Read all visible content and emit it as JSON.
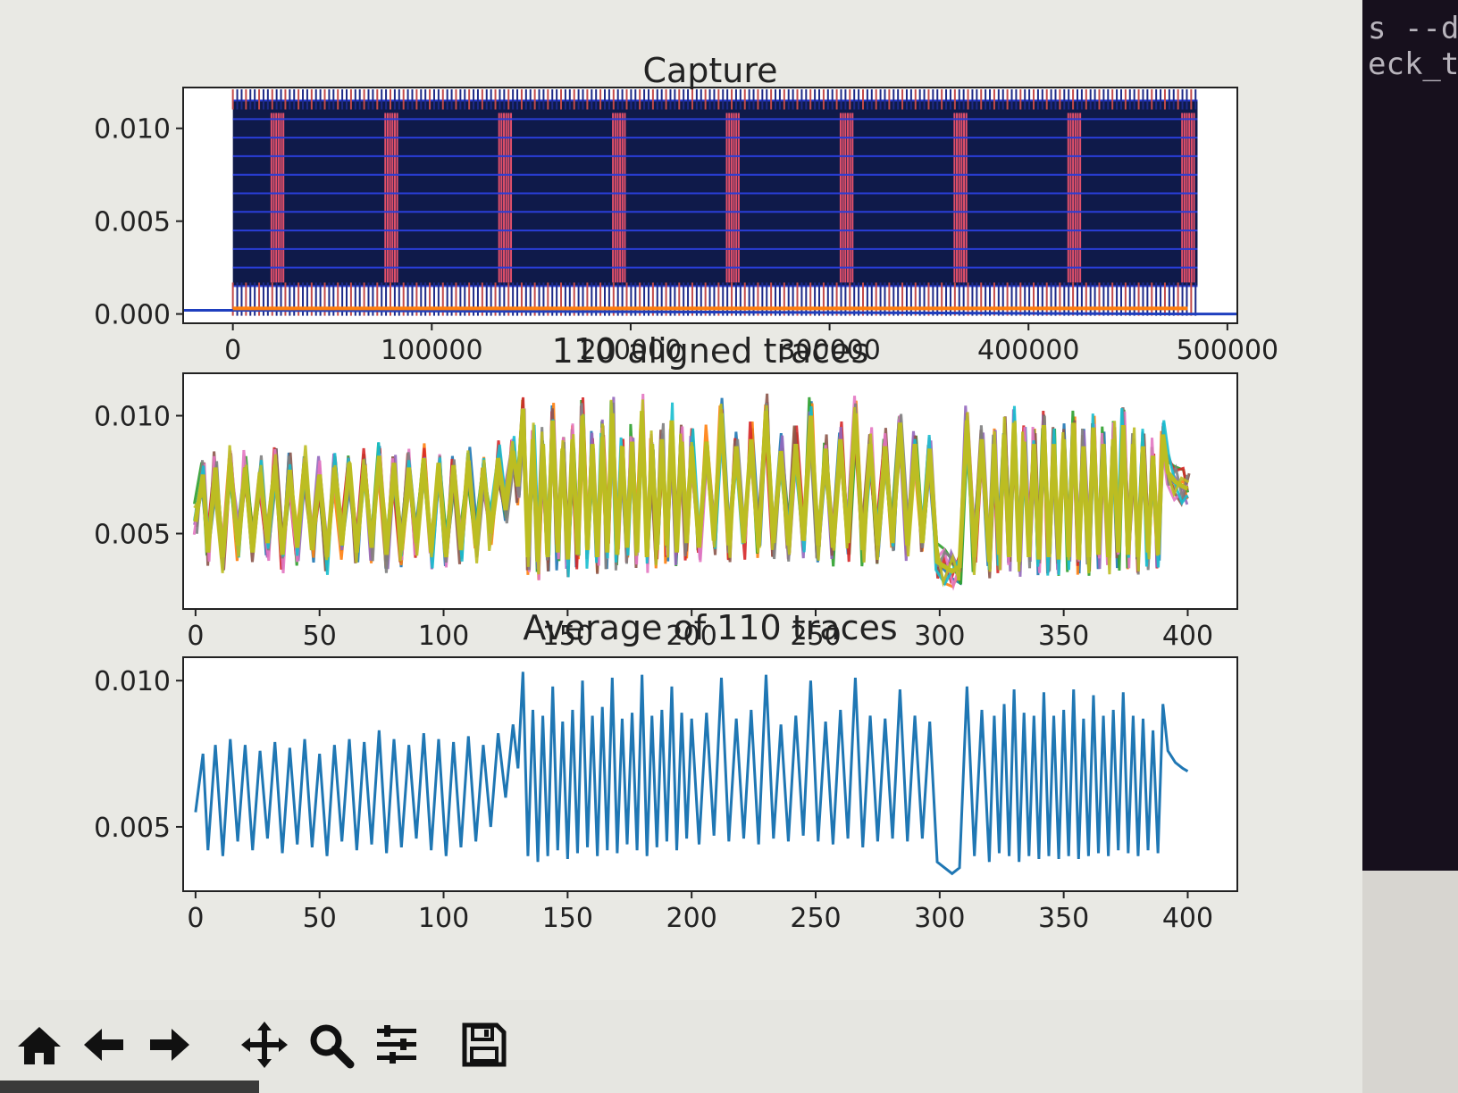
{
  "terminal": {
    "lines": [
      "s --d",
      "eck_t"
    ]
  },
  "toolbar": {
    "buttons": [
      {
        "name": "home-icon",
        "label": "Home"
      },
      {
        "name": "back-icon",
        "label": "Back"
      },
      {
        "name": "forward-icon",
        "label": "Forward"
      },
      {
        "name": "pan-icon",
        "label": "Pan"
      },
      {
        "name": "zoom-icon",
        "label": "Zoom"
      },
      {
        "name": "configure-subplots-icon",
        "label": "Configure subplots"
      },
      {
        "name": "save-icon",
        "label": "Save"
      }
    ]
  },
  "chart_data": [
    {
      "type": "line",
      "title": "Capture",
      "xlabel": "",
      "ylabel": "",
      "xlim": [
        -25000,
        505000
      ],
      "ylim": [
        -0.0005,
        0.0122
      ],
      "xticks": [
        0,
        100000,
        200000,
        300000,
        400000,
        500000
      ],
      "xtick_labels": [
        "0",
        "100000",
        "200000",
        "300000",
        "400000",
        "500000"
      ],
      "yticks": [
        0.0,
        0.005,
        0.01
      ],
      "ytick_labels": [
        "0.000",
        "0.005",
        "0.010"
      ],
      "series": [
        {
          "color": "#1f3fbf",
          "x": [
            -25000,
            0,
            480000,
            505000
          ],
          "y": [
            0.0002,
            0.0002,
            0.0,
            0.0
          ],
          "band": {
            "x0": 0,
            "x1": 485000,
            "y0": 0.0015,
            "y1": 0.0115
          }
        },
        {
          "color": "#ff7f0e",
          "x": [
            0,
            480000
          ],
          "y": [
            0.0003,
            0.0003
          ]
        }
      ],
      "grid": false
    },
    {
      "type": "line",
      "title": "110 aligned traces",
      "xlabel": "",
      "ylabel": "",
      "xlim": [
        -5,
        420
      ],
      "ylim": [
        0.0018,
        0.0118
      ],
      "xticks": [
        0,
        50,
        100,
        150,
        200,
        250,
        300,
        350,
        400
      ],
      "xtick_labels": [
        "0",
        "50",
        "100",
        "150",
        "200",
        "250",
        "300",
        "350",
        "400"
      ],
      "yticks": [
        0.005,
        0.01
      ],
      "ytick_labels": [
        "0.005",
        "0.010"
      ],
      "n_traces": 110,
      "trace_colors": [
        "#1f77b4",
        "#ff7f0e",
        "#2ca02c",
        "#d62728",
        "#9467bd",
        "#8c564b",
        "#e377c2",
        "#7f7f7f",
        "#17becf",
        "#bcbd22"
      ],
      "grid": false
    },
    {
      "type": "line",
      "title": "Average of 110 traces",
      "xlabel": "",
      "ylabel": "",
      "xlim": [
        -5,
        420
      ],
      "ylim": [
        0.0028,
        0.0108
      ],
      "xticks": [
        0,
        50,
        100,
        150,
        200,
        250,
        300,
        350,
        400
      ],
      "xtick_labels": [
        "0",
        "50",
        "100",
        "150",
        "200",
        "250",
        "300",
        "350",
        "400"
      ],
      "yticks": [
        0.005,
        0.01
      ],
      "ytick_labels": [
        "0.005",
        "0.010"
      ],
      "series": [
        {
          "color": "#1f77b4",
          "x": [
            0,
            3,
            5,
            8,
            11,
            14,
            17,
            20,
            23,
            26,
            29,
            32,
            35,
            38,
            41,
            44,
            47,
            50,
            53,
            56,
            59,
            62,
            65,
            68,
            71,
            74,
            77,
            80,
            83,
            86,
            89,
            92,
            95,
            98,
            101,
            104,
            107,
            110,
            113,
            116,
            119,
            122,
            125,
            128,
            130,
            132,
            134,
            136,
            138,
            140,
            142,
            144,
            146,
            148,
            150,
            152,
            154,
            156,
            158,
            160,
            162,
            164,
            166,
            168,
            170,
            172,
            174,
            176,
            178,
            180,
            182,
            184,
            186,
            188,
            190,
            192,
            194,
            196,
            198,
            200,
            203,
            206,
            209,
            212,
            215,
            218,
            221,
            224,
            227,
            230,
            233,
            236,
            239,
            242,
            245,
            248,
            251,
            254,
            257,
            260,
            263,
            266,
            269,
            272,
            275,
            278,
            281,
            284,
            287,
            290,
            293,
            296,
            299,
            302,
            305,
            308,
            311,
            314,
            317,
            320,
            322,
            324,
            326,
            328,
            330,
            332,
            334,
            336,
            338,
            340,
            342,
            344,
            346,
            348,
            350,
            352,
            354,
            356,
            358,
            360,
            362,
            364,
            366,
            368,
            370,
            372,
            374,
            376,
            378,
            380,
            382,
            384,
            386,
            388,
            390,
            392,
            395,
            398,
            400
          ],
          "y": [
            0.0055,
            0.0075,
            0.0042,
            0.0078,
            0.004,
            0.008,
            0.0045,
            0.0078,
            0.0042,
            0.0076,
            0.0046,
            0.0079,
            0.0041,
            0.0077,
            0.0044,
            0.008,
            0.0043,
            0.0075,
            0.004,
            0.0078,
            0.0045,
            0.008,
            0.0042,
            0.0079,
            0.0044,
            0.0083,
            0.0041,
            0.008,
            0.0043,
            0.0078,
            0.0046,
            0.0082,
            0.0042,
            0.008,
            0.004,
            0.0079,
            0.0043,
            0.0081,
            0.0045,
            0.0078,
            0.005,
            0.0082,
            0.006,
            0.0085,
            0.007,
            0.0103,
            0.004,
            0.009,
            0.0038,
            0.0088,
            0.004,
            0.0098,
            0.0042,
            0.0086,
            0.0039,
            0.009,
            0.0041,
            0.01,
            0.0043,
            0.0088,
            0.004,
            0.0091,
            0.0042,
            0.0101,
            0.0041,
            0.0087,
            0.0044,
            0.0089,
            0.0042,
            0.0102,
            0.004,
            0.0088,
            0.0043,
            0.009,
            0.0045,
            0.0098,
            0.0042,
            0.0089,
            0.0046,
            0.0087,
            0.0044,
            0.0089,
            0.0047,
            0.0101,
            0.0045,
            0.0087,
            0.0046,
            0.009,
            0.0044,
            0.0102,
            0.0046,
            0.0085,
            0.0045,
            0.0088,
            0.0047,
            0.01,
            0.0045,
            0.0086,
            0.0044,
            0.009,
            0.0046,
            0.0101,
            0.0043,
            0.0088,
            0.0045,
            0.0087,
            0.0046,
            0.0097,
            0.0045,
            0.0088,
            0.0046,
            0.0086,
            0.0038,
            0.0036,
            0.0034,
            0.0036,
            0.0098,
            0.004,
            0.009,
            0.0038,
            0.0088,
            0.0041,
            0.0092,
            0.004,
            0.0097,
            0.0038,
            0.0089,
            0.004,
            0.0088,
            0.0039,
            0.0096,
            0.004,
            0.0088,
            0.0039,
            0.009,
            0.004,
            0.0097,
            0.0039,
            0.0087,
            0.004,
            0.0095,
            0.0041,
            0.0088,
            0.004,
            0.009,
            0.0042,
            0.0096,
            0.0041,
            0.0088,
            0.004,
            0.0087,
            0.0042,
            0.0083,
            0.0041,
            0.0092,
            0.0076,
            0.0072,
            0.007,
            0.0069
          ]
        }
      ],
      "grid": false
    }
  ]
}
